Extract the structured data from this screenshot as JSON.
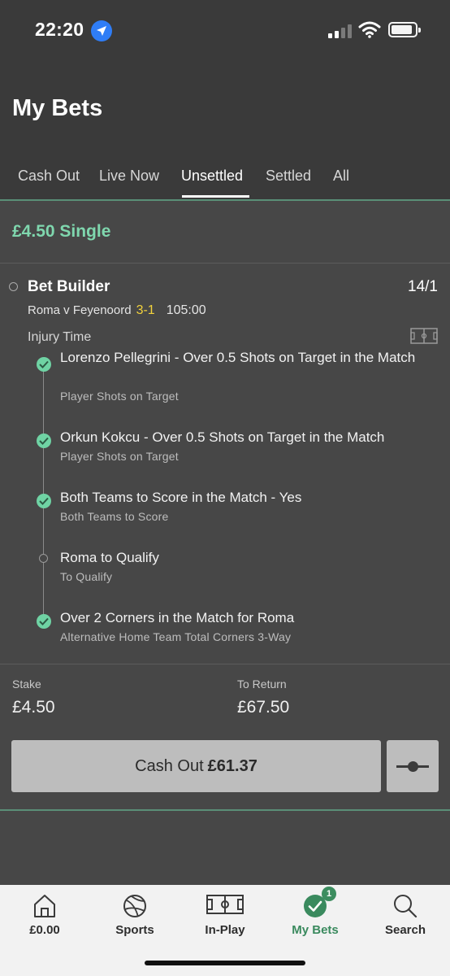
{
  "status_bar": {
    "time": "22:20",
    "icons": [
      "location-arrow-icon",
      "cellular-signal-icon",
      "wifi-icon",
      "battery-icon"
    ]
  },
  "header": {
    "title": "My Bets",
    "tabs": [
      {
        "label": "Cash Out",
        "active": false
      },
      {
        "label": "Live Now",
        "active": false
      },
      {
        "label": "Unsettled",
        "active": true
      },
      {
        "label": "Settled",
        "active": false
      },
      {
        "label": "All",
        "active": false
      }
    ]
  },
  "bet": {
    "type_label": "£4.50 Single",
    "builder_title": "Bet Builder",
    "odds": "14/1",
    "match": "Roma v Feyenoord",
    "score": "3-1",
    "match_clock": "105:00",
    "period": "Injury Time",
    "legs": [
      {
        "title": "Lorenzo Pellegrini - Over 0.5 Shots on Target in the Match",
        "market": "Player Shots on Target",
        "status": "won",
        "icon": "check-icon"
      },
      {
        "title": "Orkun Kokcu - Over 0.5 Shots on Target in the Match",
        "market": "Player Shots on Target",
        "status": "won",
        "icon": "check-icon"
      },
      {
        "title": "Both Teams to Score in the Match - Yes",
        "market": "Both Teams to Score",
        "status": "won",
        "icon": "check-icon"
      },
      {
        "title": "Roma to Qualify",
        "market": "To Qualify",
        "status": "open",
        "icon": "open-circle-icon"
      },
      {
        "title": "Over 2 Corners in the Match for Roma",
        "market": "Alternative Home Team Total Corners 3-Way",
        "status": "won",
        "icon": "check-icon"
      }
    ],
    "stake_label": "Stake",
    "stake": "£4.50",
    "return_label": "To Return",
    "to_return": "£67.50",
    "cashout_label": "Cash Out",
    "cashout_amount": "£61.37"
  },
  "tabbar": {
    "items": [
      {
        "label": "£0.00",
        "icon": "home-icon",
        "active": false
      },
      {
        "label": "Sports",
        "icon": "football-icon",
        "active": false
      },
      {
        "label": "In-Play",
        "icon": "pitch-icon",
        "active": false
      },
      {
        "label": "My Bets",
        "icon": "check-circle-icon",
        "active": true,
        "badge": "1"
      },
      {
        "label": "Search",
        "icon": "search-icon",
        "active": false
      }
    ]
  },
  "colors": {
    "accent_green": "#7fd7ae",
    "check_green": "#6fd3a4",
    "score_yellow": "#f2d23c",
    "active_tab_green": "#3a8a5e"
  }
}
